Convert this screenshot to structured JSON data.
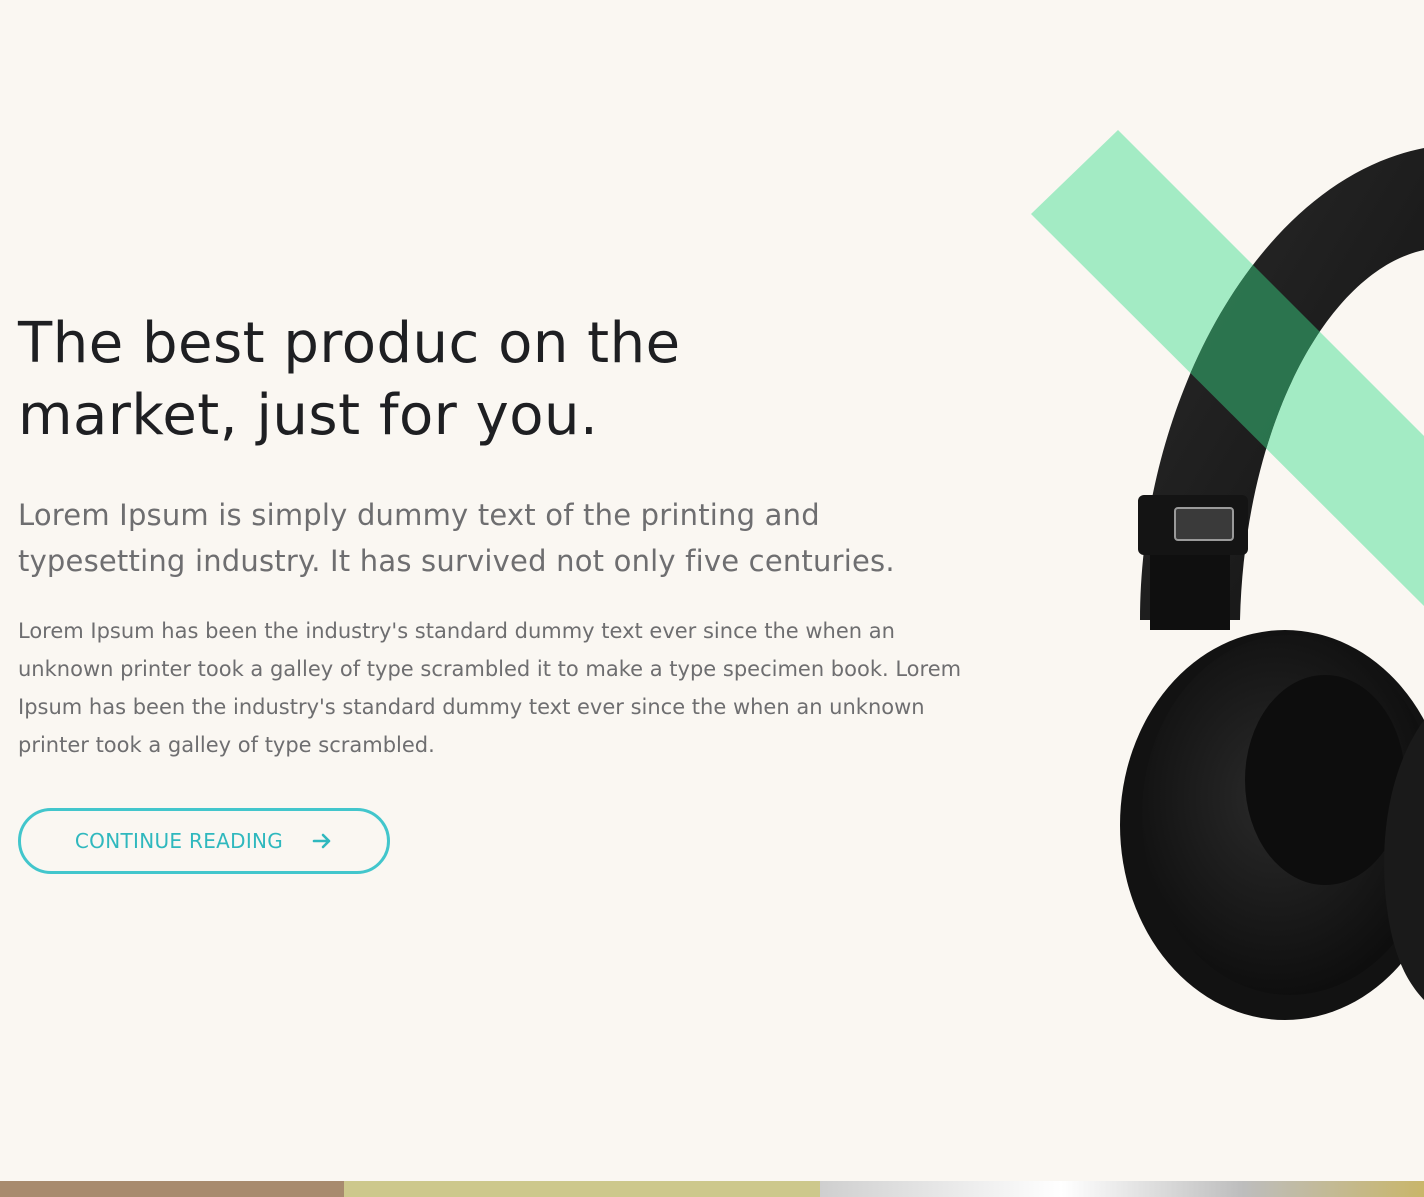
{
  "hero": {
    "headline": "The best produc on the market, just for you.",
    "lead": "Lorem Ipsum is simply dummy text of the printing and typesetting industry. It has survived not only five centuries.",
    "body": "Lorem Ipsum has been the industry's standard dummy text ever since the when an unknown printer took a galley of type scrambled it to make a type specimen book. Lorem Ipsum has been the industry's standard dummy text ever since the when an unknown printer took a galley of type scrambled.",
    "cta_label": "CONTINUE READING",
    "cta_icon": "arrow-right-icon",
    "image_subject": "headphones-icon"
  },
  "colors": {
    "background": "#faf7f2",
    "accent": "#42c6cc",
    "stripe": "#7ee6b0",
    "headline": "#1e1f22",
    "text": "#6e6e70"
  }
}
